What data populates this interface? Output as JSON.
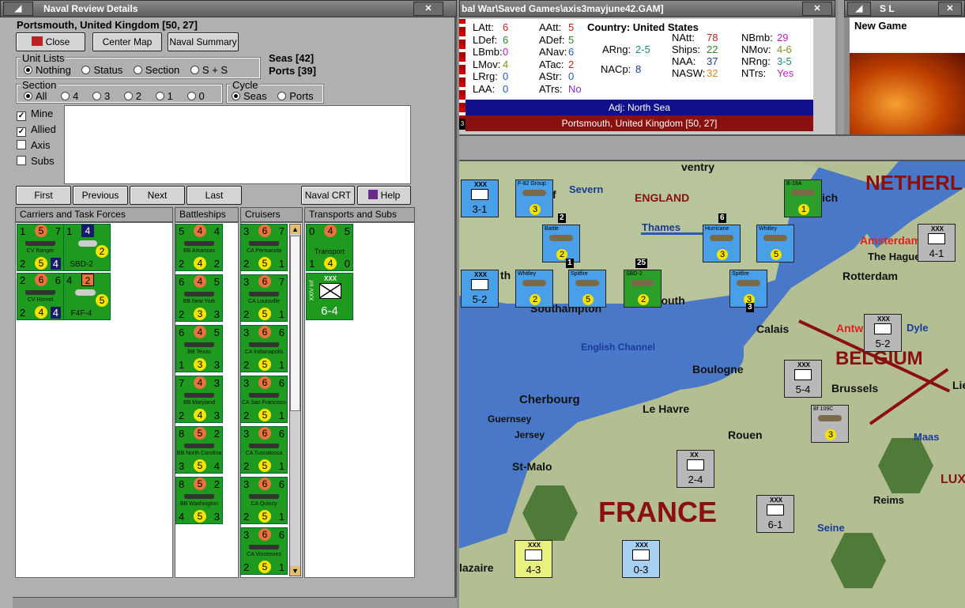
{
  "left_window": {
    "title": "Naval Review Details",
    "location": "Portsmouth, United Kingdom [50, 27]",
    "buttons": {
      "close": "Close",
      "center_map": "Center Map",
      "naval_summary": "Naval Summary"
    },
    "unit_lists": {
      "legend": "Unit Lists",
      "options": [
        "Nothing",
        "Status",
        "Section",
        "S + S"
      ],
      "selected": "Nothing"
    },
    "seas": "Seas [42]",
    "ports": "Ports [39]",
    "section": {
      "legend": "Section",
      "options": [
        "All",
        "4",
        "3",
        "2",
        "1",
        "0"
      ],
      "selected": "All"
    },
    "cycle": {
      "legend": "Cycle",
      "options": [
        "Seas",
        "Ports"
      ],
      "selected": "Seas"
    },
    "filters": [
      {
        "label": "Mine",
        "checked": true
      },
      {
        "label": "Allied",
        "checked": true
      },
      {
        "label": "Axis",
        "checked": false
      },
      {
        "label": "Subs",
        "checked": false
      }
    ],
    "nav": {
      "first": "First",
      "previous": "Previous",
      "next": "Next",
      "last": "Last",
      "naval_crt": "Naval CRT",
      "help": "Help"
    },
    "columns": [
      "Carriers and Task Forces",
      "Battleships",
      "Cruisers",
      "Transports and Subs"
    ],
    "carriers": [
      {
        "name": "CV Ranger",
        "tl": "1",
        "tc": "5",
        "tr": "7",
        "bl": "2",
        "bc": "5",
        "br": "4"
      },
      {
        "name": "CV Hornet",
        "tl": "2",
        "tc": "6",
        "tr": "6",
        "bl": "2",
        "bc": "4",
        "br": "4"
      }
    ],
    "air": [
      {
        "name": "SBD-2",
        "tl": "1",
        "tc": "4",
        "bc": "2"
      },
      {
        "name": "F4F-4",
        "tl": "4",
        "tc": "2",
        "bc": "5"
      }
    ],
    "battleships": [
      {
        "name": "BB Arkansas",
        "tl": "5",
        "tc": "4",
        "tr": "4",
        "bl": "2",
        "bc": "4",
        "br": "2"
      },
      {
        "name": "BB New York",
        "tl": "6",
        "tc": "4",
        "tr": "5",
        "bl": "2",
        "bc": "3",
        "br": "3"
      },
      {
        "name": "BB Texas",
        "tl": "6",
        "tc": "4",
        "tr": "5",
        "bl": "1",
        "bc": "3",
        "br": "3"
      },
      {
        "name": "BB Maryland",
        "tl": "7",
        "tc": "4",
        "tr": "3",
        "bl": "2",
        "bc": "4",
        "br": "3"
      },
      {
        "name": "BB North Carolina",
        "tl": "8",
        "tc": "5",
        "tr": "2",
        "bl": "3",
        "bc": "5",
        "br": "4"
      },
      {
        "name": "BB Washington",
        "tl": "8",
        "tc": "5",
        "tr": "2",
        "bl": "4",
        "bc": "5",
        "br": "3"
      }
    ],
    "cruisers": [
      {
        "name": "CA Pensacola",
        "tl": "3",
        "tc": "6",
        "tr": "7",
        "bl": "2",
        "bc": "5",
        "br": "1"
      },
      {
        "name": "CA Louisville",
        "tl": "3",
        "tc": "6",
        "tr": "7",
        "bl": "2",
        "bc": "5",
        "br": "1"
      },
      {
        "name": "CA Indianapolis",
        "tl": "3",
        "tc": "6",
        "tr": "6",
        "bl": "2",
        "bc": "5",
        "br": "1"
      },
      {
        "name": "CA San Francisco",
        "tl": "3",
        "tc": "6",
        "tr": "6",
        "bl": "2",
        "bc": "5",
        "br": "1"
      },
      {
        "name": "CA Tuscaloosa",
        "tl": "3",
        "tc": "6",
        "tr": "6",
        "bl": "2",
        "bc": "5",
        "br": "1"
      },
      {
        "name": "CA Quincy",
        "tl": "3",
        "tc": "6",
        "tr": "6",
        "bl": "2",
        "bc": "5",
        "br": "1"
      },
      {
        "name": "CA Vincennes",
        "tl": "3",
        "tc": "6",
        "tr": "6",
        "bl": "2",
        "bc": "5",
        "br": "1"
      }
    ],
    "transport": {
      "name": "Transport",
      "tl": "0",
      "tc": "4",
      "tr": "5",
      "bl": "1",
      "bc": "4",
      "br": "0"
    },
    "land_unit": {
      "label": "XXIV Inf",
      "size": "XXX",
      "value": "6-4"
    }
  },
  "middle_window": {
    "title": "bal War\\Saved Games\\axis3mayjune42.GAM]",
    "stats_col1": [
      "LAtt:",
      "LDef:",
      "LBmb:",
      "LMov:",
      "LRrg:",
      "LAA:"
    ],
    "stats_col1_vals": [
      "6",
      "6",
      "0",
      "4",
      "0",
      "0"
    ],
    "stats_col2": [
      "AAtt:",
      "ADef:",
      "ANav:",
      "ATac:",
      "AStr:",
      "ATrs:"
    ],
    "stats_col2_vals": [
      "5",
      "5",
      "6",
      "2",
      "0",
      "No"
    ],
    "country": "Country: United States",
    "arng_label": "ARng:",
    "arng": "2-5",
    "nacp_label": "NACp:",
    "nacp": "8",
    "stats_col4": [
      "NAtt:",
      "Ships:",
      "NAA:",
      "NASW:"
    ],
    "stats_col4_vals": [
      "78",
      "22",
      "37",
      "32"
    ],
    "stats_col5": [
      "NBmb:",
      "NMov:",
      "NRng:",
      "NTrs:"
    ],
    "stats_col5_vals": [
      "29",
      "4-6",
      "3-5",
      "Yes"
    ],
    "adj": "Adj: North Sea",
    "location": "Portsmouth, United Kingdom [50, 27]",
    "location_badge": "3"
  },
  "right_window": {
    "title": "S L",
    "item": "New Game"
  },
  "map": {
    "labels": {
      "netherlands": "NETHERL",
      "england": "ENGLAND",
      "severn": "Severn",
      "thames": "Thames",
      "amsterdam": "Amsterdam",
      "hague": "The Hague",
      "rotterdam": "Rotterdam",
      "antwerp": "Antw",
      "dyle": "Dyle",
      "calais": "Calais",
      "belgium": "BELGIUM",
      "channel": "English Channel",
      "boulogne": "Boulogne",
      "brussels": "Brussels",
      "lie": "Lie",
      "cherbourg": "Cherbourg",
      "le_havre": "Le Havre",
      "guernsey": "Guernsey",
      "jersey": "Jersey",
      "rouen": "Rouen",
      "maas": "Maas",
      "st_malo": "St-Malo",
      "france": "FRANCE",
      "reims": "Reims",
      "seine": "Seine",
      "lux": "LUX",
      "nazaire": "lazaire",
      "southampton": "Southampton",
      "plymouth": "mouth",
      "wich": "ich",
      "ventry": "ventry",
      "th": "th",
      "f": "f"
    },
    "units": [
      {
        "id": "u1",
        "top": "XXX",
        "main": "3-1",
        "color": "blue"
      },
      {
        "id": "u2",
        "name": "F-82 Group",
        "main": "3",
        "color": "blue"
      },
      {
        "id": "u3",
        "name": "B-18A",
        "main": "1",
        "color": "green"
      },
      {
        "id": "u4",
        "name": "Battle",
        "main": "2",
        "color": "blue"
      },
      {
        "id": "u5",
        "name": "Hurricane",
        "main": "3",
        "color": "blue"
      },
      {
        "id": "u6",
        "name": "Whitley",
        "main": "5",
        "color": "blue"
      },
      {
        "id": "u7",
        "top": "XXX",
        "main": "4-1",
        "color": "gray"
      },
      {
        "id": "u8",
        "top": "XXX",
        "main": "5-2",
        "color": "blue"
      },
      {
        "id": "u9",
        "name": "Whitley",
        "main": "2",
        "color": "blue"
      },
      {
        "id": "u10",
        "name": "Spitfire",
        "main": "5",
        "color": "blue"
      },
      {
        "id": "u11",
        "name": "SBD-2",
        "main": "2",
        "color": "green"
      },
      {
        "id": "u12",
        "name": "Spitfire",
        "main": "3",
        "color": "blue"
      },
      {
        "id": "u13",
        "top": "XXX",
        "main": "5-2",
        "color": "gray"
      },
      {
        "id": "u14",
        "top": "XXX",
        "main": "5-4",
        "color": "gray"
      },
      {
        "id": "u15",
        "name": "Bf 109C",
        "main": "3",
        "color": "gray"
      },
      {
        "id": "u16",
        "top": "XX",
        "main": "2-4",
        "color": "gray"
      },
      {
        "id": "u17",
        "top": "XXX",
        "main": "6-1",
        "color": "gray"
      },
      {
        "id": "u18",
        "top": "XXX",
        "main": "4-3",
        "color": "yellow"
      },
      {
        "id": "u19",
        "top": "XXX",
        "main": "0-3",
        "color": "lightblue"
      }
    ],
    "stack_counts": [
      "2",
      "6",
      "1",
      "25",
      "3"
    ]
  }
}
